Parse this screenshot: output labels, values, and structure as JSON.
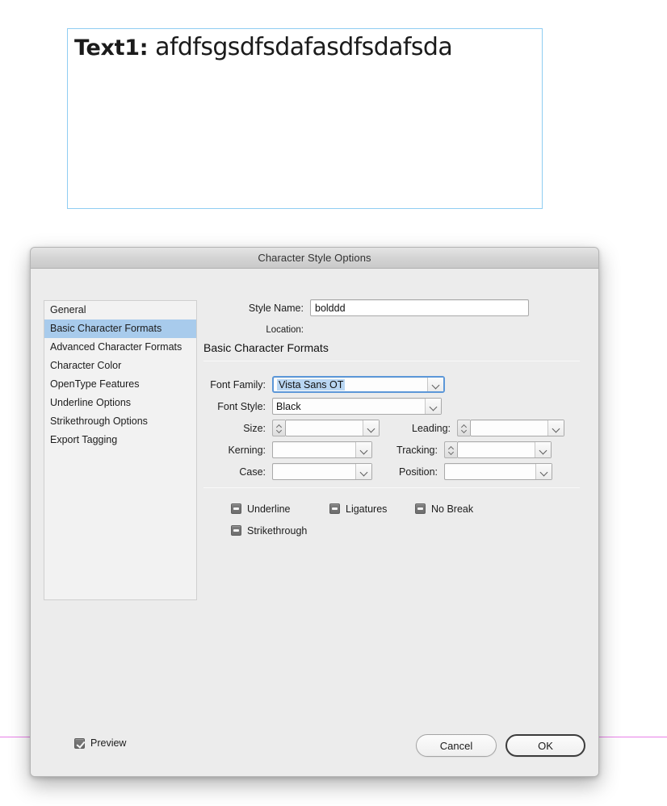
{
  "document": {
    "text_frame": {
      "label": "Text1:",
      "body": " afdfsgsdfsdafasdfsdafsda"
    }
  },
  "dialog": {
    "title": "Character Style Options",
    "sidebar": {
      "items": [
        {
          "label": "General",
          "selected": false
        },
        {
          "label": "Basic Character Formats",
          "selected": true
        },
        {
          "label": "Advanced Character Formats",
          "selected": false
        },
        {
          "label": "Character Color",
          "selected": false
        },
        {
          "label": "OpenType Features",
          "selected": false
        },
        {
          "label": "Underline Options",
          "selected": false
        },
        {
          "label": "Strikethrough Options",
          "selected": false
        },
        {
          "label": "Export Tagging",
          "selected": false
        }
      ]
    },
    "style_name": {
      "label": "Style Name:",
      "value": "bolddd",
      "placeholder": ""
    },
    "location": {
      "label": "Location:",
      "value": ""
    },
    "section_heading": "Basic Character Formats",
    "fields": {
      "font_family": {
        "label": "Font Family:",
        "value": "Vista Sans OT",
        "selected_text": true
      },
      "font_style": {
        "label": "Font Style:",
        "value": "Black"
      },
      "size": {
        "label": "Size:",
        "value": ""
      },
      "leading": {
        "label": "Leading:",
        "value": ""
      },
      "kerning": {
        "label": "Kerning:",
        "value": ""
      },
      "tracking": {
        "label": "Tracking:",
        "value": ""
      },
      "case": {
        "label": "Case:",
        "value": ""
      },
      "position": {
        "label": "Position:",
        "value": ""
      }
    },
    "checkboxes": [
      {
        "label": "Underline",
        "state": "mixed"
      },
      {
        "label": "Ligatures",
        "state": "mixed"
      },
      {
        "label": "No Break",
        "state": "mixed"
      },
      {
        "label": "Strikethrough",
        "state": "mixed"
      }
    ],
    "footer": {
      "preview_label": "Preview",
      "preview_checked": true,
      "cancel_label": "Cancel",
      "ok_label": "OK"
    }
  },
  "colors": {
    "selection_blue": "#a8cbec",
    "text_selection": "#b9d6f2",
    "frame_border": "#8fcdf2",
    "margin_guide": "#e87fe8",
    "dialog_bg": "#ececec",
    "focus_border": "#5c97d8"
  }
}
